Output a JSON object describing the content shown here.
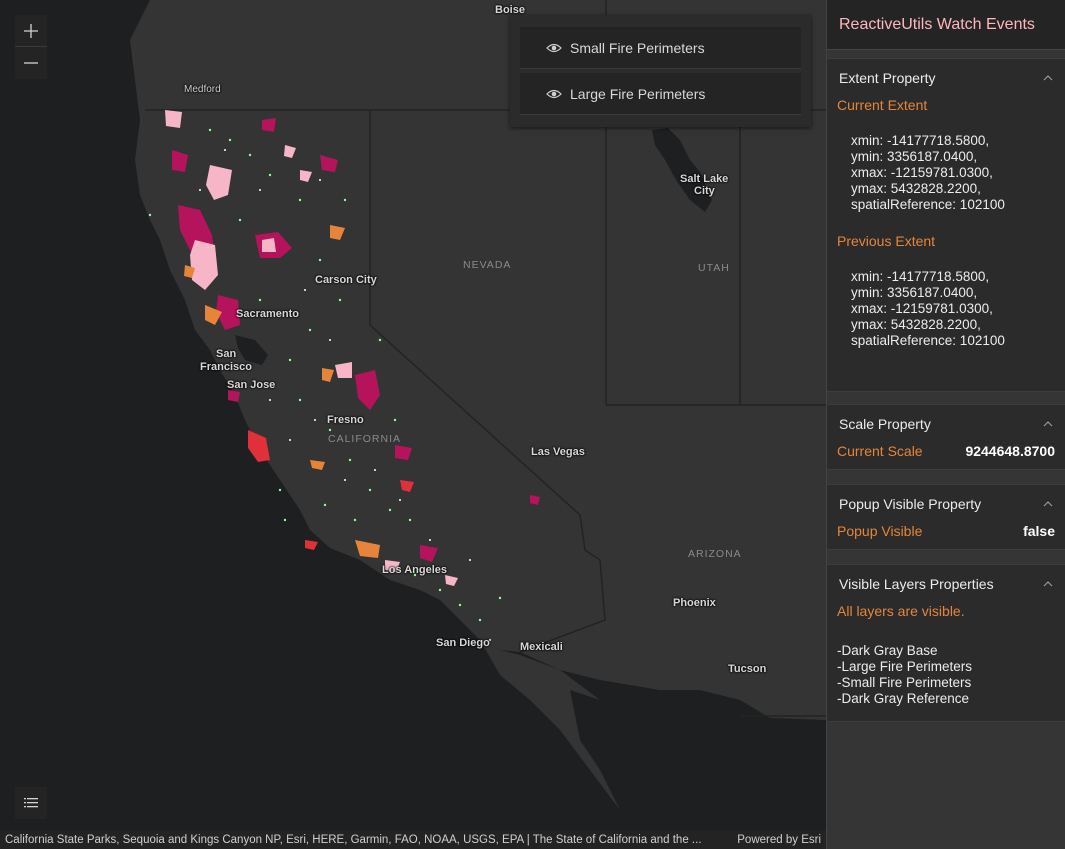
{
  "map": {
    "zoom_in_label": "+",
    "zoom_out_label": "—",
    "labels": {
      "boise": "Boise",
      "medford": "Medford",
      "carson_city": "Carson City",
      "nevada": "NEVADA",
      "utah": "UTAH",
      "salt_lake_1": "Salt Lake",
      "salt_lake_2": "City",
      "sacramento": "Sacramento",
      "san_francisco_1": "San",
      "san_francisco_2": "Francisco",
      "san_jose": "San Jose",
      "fresno": "Fresno",
      "california": "CALIFORNIA",
      "las_vegas": "Las Vegas",
      "arizona": "ARIZONA",
      "los_angeles": "Los Angeles",
      "phoenix": "Phoenix",
      "san_diego": "San Diego",
      "mexicali": "Mexicali",
      "tucson": "Tucson"
    },
    "attribution": "California State Parks, Sequoia and Kings Canyon NP, Esri, HERE, Garmin, FAO, NOAA, USGS, EPA | The State of California and the ...",
    "powered_by": "Powered by Esri"
  },
  "layer_list": {
    "items": [
      {
        "label": "Small Fire Perimeters",
        "icon": "eye-icon"
      },
      {
        "label": "Large Fire Perimeters",
        "icon": "eye-icon"
      }
    ]
  },
  "panel": {
    "title": "ReactiveUtils Watch Events",
    "extent": {
      "header": "Extent Property",
      "current_label": "Current Extent",
      "current": [
        "xmin: -14177718.5800,",
        "ymin: 3356187.0400,",
        "xmax: -12159781.0300,",
        "ymax: 5432828.2200,",
        "spatialReference: 102100"
      ],
      "previous_label": "Previous Extent",
      "previous": [
        "xmin: -14177718.5800,",
        "ymin: 3356187.0400,",
        "xmax: -12159781.0300,",
        "ymax: 5432828.2200,",
        "spatialReference: 102100"
      ]
    },
    "scale": {
      "header": "Scale Property",
      "label": "Current Scale",
      "value": "9244648.8700"
    },
    "popup": {
      "header": "Popup Visible Property",
      "label": "Popup Visible",
      "value": "false"
    },
    "visible_layers": {
      "header": "Visible Layers Properties",
      "status": "All layers are visible.",
      "layers": [
        "-Dark Gray Base",
        "-Large Fire Perimeters",
        "-Small Fire Perimeters",
        "-Dark Gray Reference"
      ]
    }
  },
  "colors": {
    "title": "#ffb7b7",
    "accent_orange": "#e6853a",
    "fire_magenta": "#b5135c",
    "fire_pink": "#f7b6c7",
    "fire_orange": "#e6853a",
    "fire_red": "#e0303a",
    "fire_green": "#8bff9c"
  }
}
